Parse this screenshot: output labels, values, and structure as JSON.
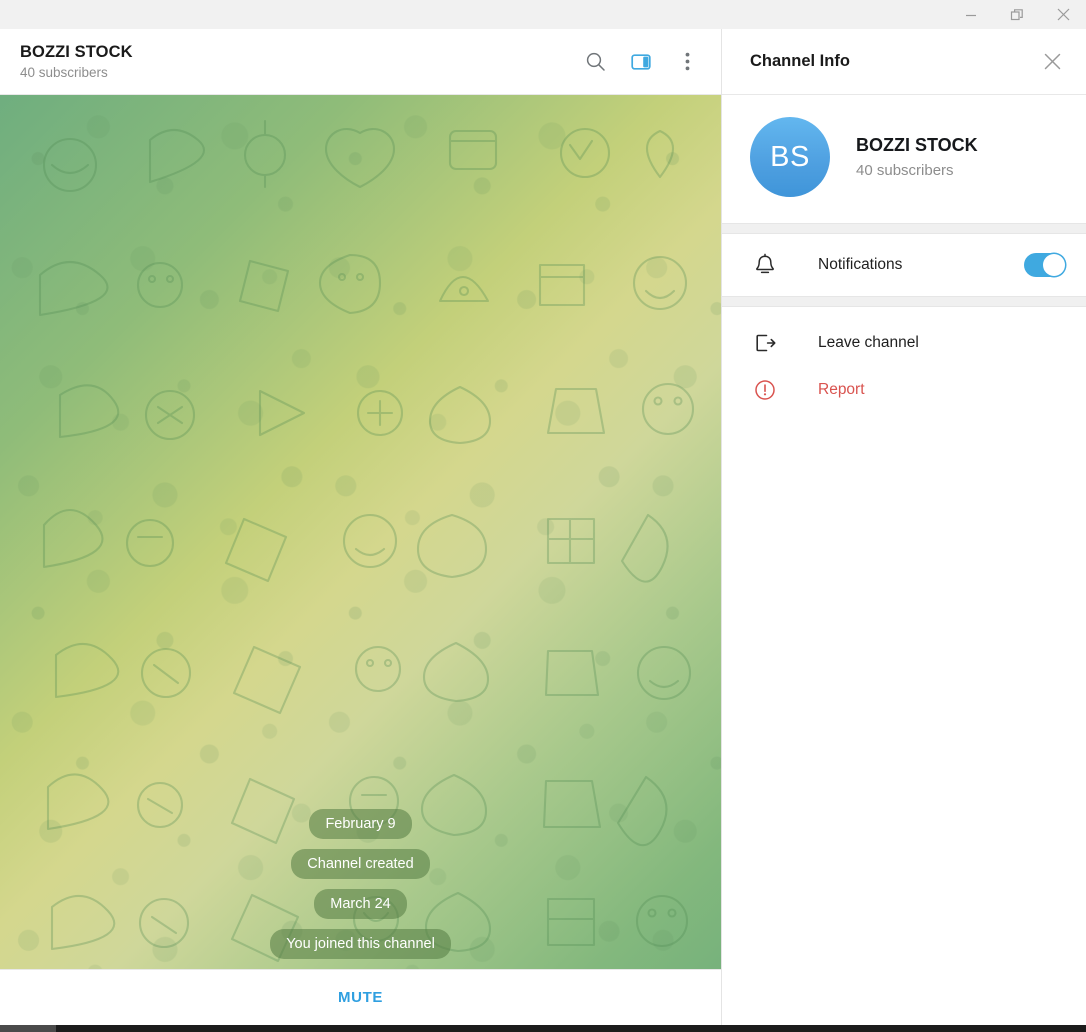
{
  "window": {
    "controls": [
      {
        "name": "minimize",
        "label": "–"
      },
      {
        "name": "restore",
        "label": "❐"
      },
      {
        "name": "close",
        "label": "✕"
      }
    ]
  },
  "chat": {
    "title": "BOZZI STOCK",
    "subtitle": "40 subscribers",
    "header_actions": [
      {
        "name": "search-icon",
        "label": "Search",
        "active": false
      },
      {
        "name": "sidebar-toggle-icon",
        "label": "Channel Info",
        "active": true
      },
      {
        "name": "more-menu-icon",
        "label": "More",
        "active": false
      }
    ],
    "messages": [
      {
        "type": "date",
        "text": "February 9"
      },
      {
        "type": "service",
        "text": "Channel created"
      },
      {
        "type": "date",
        "text": "March 24"
      },
      {
        "type": "service",
        "text": "You joined this channel"
      }
    ],
    "mute_button": "MUTE"
  },
  "info_panel": {
    "title": "Channel Info",
    "close_label": "Close",
    "avatar_initials": "BS",
    "channel_name": "BOZZI STOCK",
    "subscribers": "40 subscribers",
    "notifications": {
      "label": "Notifications",
      "icon": "bell-icon",
      "enabled": true
    },
    "actions": [
      {
        "name": "leave-channel",
        "label": "Leave channel",
        "icon": "exit-icon",
        "danger": false
      },
      {
        "name": "report",
        "label": "Report",
        "icon": "report-icon",
        "danger": true
      }
    ]
  },
  "colors": {
    "accent": "#3fa9e0",
    "danger": "#d9534f",
    "avatar": "#4e9fe0",
    "mute": "#2f9fe0",
    "wallpaper_green": "#6fae7f",
    "wallpaper_yellow": "#d4d78d"
  }
}
